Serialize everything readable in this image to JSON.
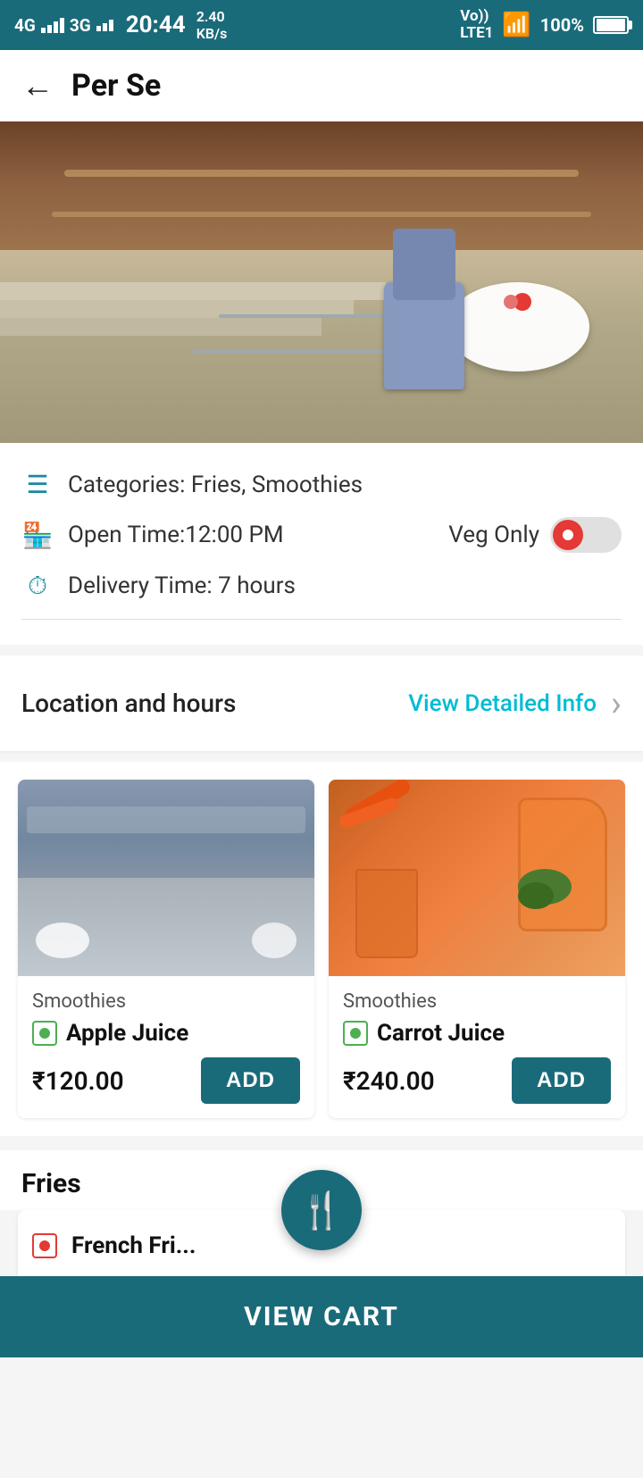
{
  "statusBar": {
    "time": "20:44",
    "network": "4G 3G",
    "speed": "2.40\nKB/s",
    "lte": "Vo))\nLTE1",
    "wifi": "WiFi",
    "battery": "100%"
  },
  "header": {
    "backLabel": "←",
    "title": "Per Se"
  },
  "restaurantInfo": {
    "categoriesIcon": "≡",
    "categoriesText": "Categories: Fries, Smoothies",
    "openIcon": "🏪",
    "openText": "Open Time:12:00 PM",
    "vegOnlyLabel": "Veg Only",
    "deliveryIcon": "⏱",
    "deliveryText": "Delivery Time: 7 hours"
  },
  "locationSection": {
    "locationText": "Location and hours",
    "viewDetailedText": "View Detailed Info",
    "chevron": "›"
  },
  "menuItems": [
    {
      "category": "Smoothies",
      "name": "Apple Juice",
      "price": "₹120.00",
      "addLabel": "ADD",
      "vegType": "veg"
    },
    {
      "category": "Smoothies",
      "name": "Carrot Juice",
      "price": "₹240.00",
      "addLabel": "ADD",
      "vegType": "veg"
    }
  ],
  "friesSection": {
    "title": "Fries"
  },
  "fab": {
    "icon": "🍴"
  },
  "viewCart": {
    "label": "VIEW CART"
  }
}
